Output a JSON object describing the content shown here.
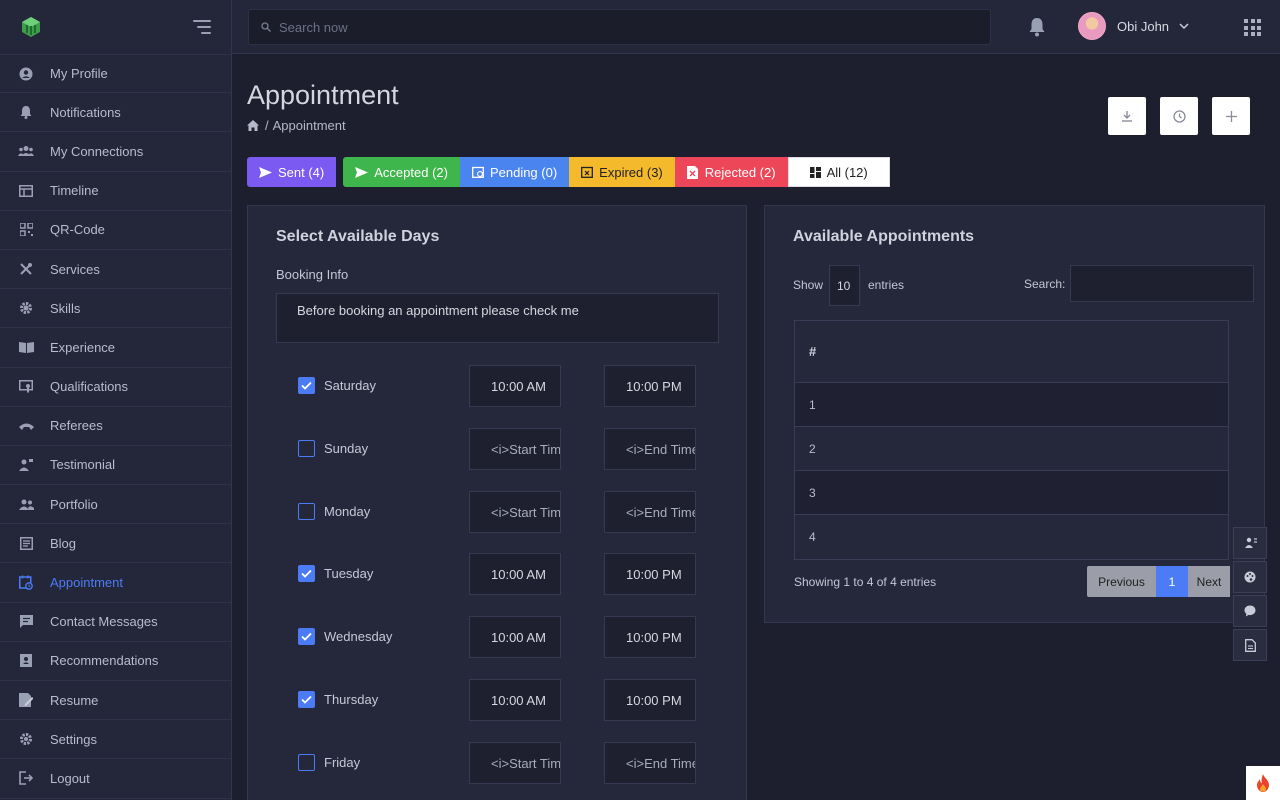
{
  "sidebar": {
    "items": [
      {
        "label": "My Profile",
        "icon": "user-circle-icon"
      },
      {
        "label": "Notifications",
        "icon": "bell-icon"
      },
      {
        "label": "My Connections",
        "icon": "users-icon"
      },
      {
        "label": "Timeline",
        "icon": "timeline-icon"
      },
      {
        "label": "QR-Code",
        "icon": "qr-code-icon"
      },
      {
        "label": "Services",
        "icon": "tools-icon"
      },
      {
        "label": "Skills",
        "icon": "gear-icon"
      },
      {
        "label": "Experience",
        "icon": "book-icon"
      },
      {
        "label": "Qualifications",
        "icon": "certificate-icon"
      },
      {
        "label": "Referees",
        "icon": "phone-icon"
      },
      {
        "label": "Testimonial",
        "icon": "testimonial-icon"
      },
      {
        "label": "Portfolio",
        "icon": "portfolio-icon"
      },
      {
        "label": "Blog",
        "icon": "blog-icon"
      },
      {
        "label": "Appointment",
        "icon": "calendar-clock-icon",
        "active": true
      },
      {
        "label": "Contact Messages",
        "icon": "message-icon"
      },
      {
        "label": "Recommendations",
        "icon": "recommendation-icon"
      },
      {
        "label": "Resume",
        "icon": "resume-icon"
      },
      {
        "label": "Settings",
        "icon": "settings-icon"
      },
      {
        "label": "Logout",
        "icon": "logout-icon"
      }
    ]
  },
  "topbar": {
    "search_placeholder": "Search now",
    "user_name": "Obi John"
  },
  "header": {
    "title": "Appointment",
    "breadcrumb": "Appointment"
  },
  "tabs": [
    {
      "label": "Sent (4)"
    },
    {
      "label": "Accepted (2)"
    },
    {
      "label": "Pending (0)"
    },
    {
      "label": "Expired (3)"
    },
    {
      "label": "Rejected (2)"
    },
    {
      "label": "All (12)"
    }
  ],
  "days_card": {
    "title": "Select Available Days",
    "booking_label": "Booking Info",
    "booking_text": "Before booking an appointment please check me",
    "days": [
      {
        "name": "Saturday",
        "checked": true,
        "start": "10:00 AM",
        "end": "10:00 PM"
      },
      {
        "name": "Sunday",
        "checked": false,
        "start": "",
        "end": ""
      },
      {
        "name": "Monday",
        "checked": false,
        "start": "",
        "end": ""
      },
      {
        "name": "Tuesday",
        "checked": true,
        "start": "10:00 AM",
        "end": "10:00 PM"
      },
      {
        "name": "Wednesday",
        "checked": true,
        "start": "10:00 AM",
        "end": "10:00 PM"
      },
      {
        "name": "Thursday",
        "checked": true,
        "start": "10:00 AM",
        "end": "10:00 PM"
      },
      {
        "name": "Friday",
        "checked": false,
        "start": "",
        "end": ""
      }
    ],
    "start_placeholder": "<i>Start Time",
    "end_placeholder": "<i>End Time"
  },
  "appointments_card": {
    "title": "Available Appointments",
    "show_label": "Show",
    "length_value": "10",
    "entries_label": "entries",
    "search_label": "Search:",
    "column_header": "#",
    "rows": [
      "1",
      "2",
      "3",
      "4"
    ],
    "info": "Showing 1 to 4 of 4 entries",
    "prev_label": "Previous",
    "current_page": "1",
    "next_label": "Next"
  },
  "colors": {
    "accent": "#4b7bf5",
    "sent": "#7a5af0",
    "accepted": "#3fb64c",
    "pending": "#4a85ef",
    "expired": "#f5b92c",
    "rejected": "#ec4658"
  }
}
